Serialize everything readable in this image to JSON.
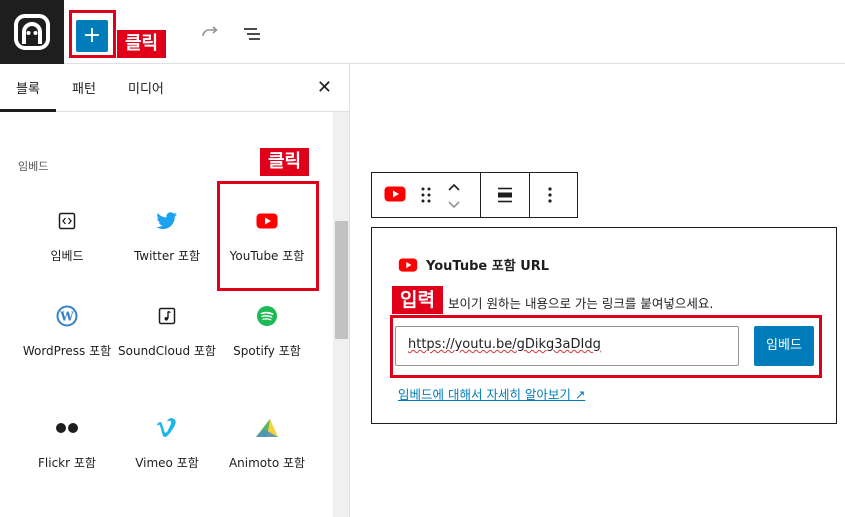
{
  "topbar": {
    "inserter_symbol": "+",
    "callout_click": "클릭"
  },
  "panel": {
    "tabs": [
      "블록",
      "패턴",
      "미디어"
    ],
    "close_symbol": "✕",
    "category_label": "임베드",
    "callout_click": "클릭",
    "blocks": [
      {
        "label": "임베드",
        "icon": "embed-generic-icon"
      },
      {
        "label": "Twitter 포함",
        "icon": "twitter-icon"
      },
      {
        "label": "YouTube 포함",
        "icon": "youtube-icon"
      },
      {
        "label": "WordPress 포함",
        "icon": "wordpress-icon"
      },
      {
        "label": "SoundCloud 포함",
        "icon": "soundcloud-icon"
      },
      {
        "label": "Spotify 포함",
        "icon": "spotify-icon"
      },
      {
        "label": "Flickr 포함",
        "icon": "flickr-icon"
      },
      {
        "label": "Vimeo 포함",
        "icon": "vimeo-icon"
      },
      {
        "label": "Animoto 포함",
        "icon": "animoto-icon"
      }
    ]
  },
  "embed": {
    "title": "YouTube 포함 URL",
    "instruction_visible": "보이기 원하는 내용으로 가는 링크를 붙여넣으세요.",
    "callout_input": "입력",
    "url_value": "https://youtu.be/gDikg3aDIdg",
    "embed_button": "임베드",
    "learn_more": "임베드에 대해서 자세히 알아보기 ↗"
  },
  "colors": {
    "accent": "#007cba",
    "highlight": "#e0001a",
    "youtube": "#ff0000",
    "twitter": "#1da1f2",
    "wordpress": "#3582c4",
    "spotify": "#1db954",
    "vimeo": "#1ab7ea"
  }
}
